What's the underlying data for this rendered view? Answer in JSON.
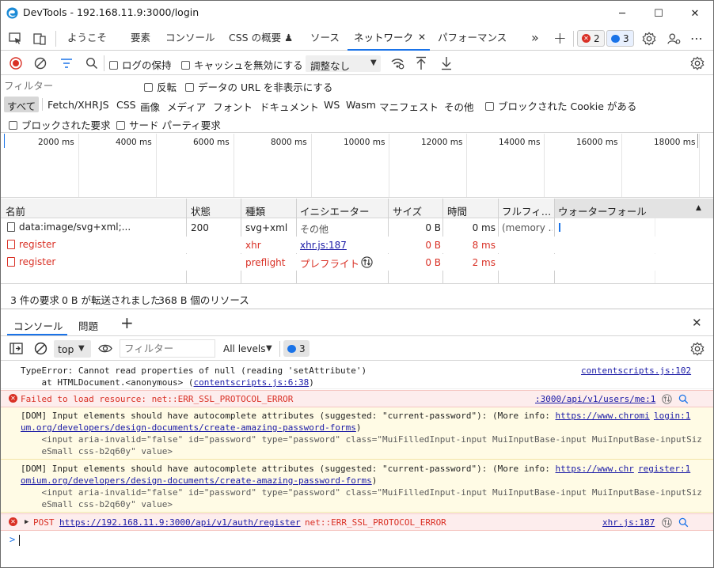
{
  "window": {
    "title": "DevTools - 192.168.11.9:3000/login",
    "minimize": "─",
    "maximize": "☐",
    "close": "✕"
  },
  "tabs": {
    "items": [
      {
        "label": "ようこそ"
      },
      {
        "label": "要素"
      },
      {
        "label": "コンソール"
      },
      {
        "label": "CSS の概要 ♟"
      },
      {
        "label": "ソース"
      },
      {
        "label": "ネットワーク"
      },
      {
        "label": "パフォーマンス"
      }
    ],
    "active_close": "✕",
    "more": "»",
    "add": "+",
    "errors_count": "2",
    "messages_count": "3",
    "menu": "⋯"
  },
  "network_toolbar": {
    "preserve_log": "ログの保持",
    "disable_cache": "キャッシュを無効にする",
    "throttling": "調整なし"
  },
  "filter_bar": {
    "placeholder": "フィルター",
    "invert": "反転",
    "hide_data_urls": "データの URL を非表示にする"
  },
  "type_filters": {
    "items": [
      "すべて",
      "Fetch/XHR",
      "JS",
      "CSS",
      "画像",
      "メディア",
      "フォント",
      "ドキュメント",
      "WS",
      "Wasm",
      "マニフェスト",
      "その他"
    ],
    "blocked_cookies": "ブロックされた Cookie がある",
    "blocked_requests": "ブロックされた要求",
    "third_party": "サード パーティ要求"
  },
  "timeline": {
    "ticks": [
      "2000 ms",
      "4000 ms",
      "6000 ms",
      "8000 ms",
      "10000 ms",
      "12000 ms",
      "14000 ms",
      "16000 ms",
      "18000 ms"
    ]
  },
  "table": {
    "headers": [
      "名前",
      "状態",
      "種類",
      "イニシエーター",
      "サイズ",
      "時間",
      "フルフィ…",
      "ウォーターフォール"
    ],
    "sort_indicator": "▲",
    "rows": [
      {
        "name": "data:image/svg+xml;...",
        "status": "200",
        "type": "svg+xml",
        "initiator": "その他",
        "size": "0 B",
        "time": "0 ms",
        "fulfilled": "(memory ...",
        "error": false
      },
      {
        "name": "register",
        "status": "",
        "type": "xhr",
        "initiator": "xhr.js:187",
        "size": "0 B",
        "time": "8 ms",
        "fulfilled": "",
        "error": true
      },
      {
        "name": "register",
        "status": "",
        "type": "preflight",
        "initiator": "プレフライト",
        "size": "0 B",
        "time": "2 ms",
        "fulfilled": "",
        "error": true
      }
    ]
  },
  "summary": {
    "requests": "3 件の要求",
    "transferred": "0 B が転送されました",
    "resources": "368 B 個のリソース"
  },
  "drawer": {
    "tabs": [
      "コンソール",
      "問題"
    ],
    "add": "+",
    "close": "✕"
  },
  "console_toolbar": {
    "context": "top",
    "filter_placeholder": "フィルター",
    "levels": "All levels",
    "messages_count": "3"
  },
  "console": {
    "entries": [
      {
        "kind": "plain",
        "lines": [
          "TypeError: Cannot read properties of null (reading 'setAttribute')",
          "    at HTMLDocument.<anonymous> ("
        ],
        "inline_link": "contentscripts.js:6:38",
        "inline_tail": ")",
        "source": "contentscripts.js:102"
      },
      {
        "kind": "error",
        "text": "Failed to load resource: net::ERR_SSL_PROTOCOL_ERROR",
        "source": ":3000/api/v1/users/me:1"
      },
      {
        "kind": "warning",
        "line1_pre": "[DOM] Input elements should have autocomplete attributes (suggested: \"current-password\"): (More info: ",
        "line1_link": "https://www.chromi",
        "line2_link": "um.org/developers/design-documents/create-amazing-password-forms",
        "line2_tail": ")",
        "line3": "    <input aria-invalid=\"false\" id=\"password\" type=\"password\" class=\"MuiFilledInput-input MuiInputBase-input MuiInputBase-inputSiz",
        "line4": "    eSmall css-b2q60y\" value>",
        "source_a": "login:1"
      },
      {
        "kind": "warning",
        "line1_pre": "[DOM] Input elements should have autocomplete attributes (suggested: \"current-password\"): (More info: ",
        "line1_link": "https://www.chr",
        "line2_link": "omium.org/developers/design-documents/create-amazing-password-forms",
        "line2_tail": ")",
        "line3": "    <input aria-invalid=\"false\" id=\"password\" type=\"password\" class=\"MuiFilledInput-input MuiInputBase-input MuiInputBase-inputSiz",
        "line4": "    eSmall css-b2q60y\" value>",
        "source_a": "register:1"
      },
      {
        "kind": "error",
        "method": "POST",
        "url": "https://192.168.11.9:3000/api/v1/auth/register",
        "err": "net::ERR_SSL_PROTOCOL_ERROR",
        "source": "xhr.js:187"
      }
    ],
    "prompt": ">"
  },
  "colors": {
    "accent": "#1a73e8",
    "error_text": "#d93025",
    "error_bg": "#fdeded",
    "warning_bg": "#fffbe5",
    "link": "#1a1aa6"
  }
}
